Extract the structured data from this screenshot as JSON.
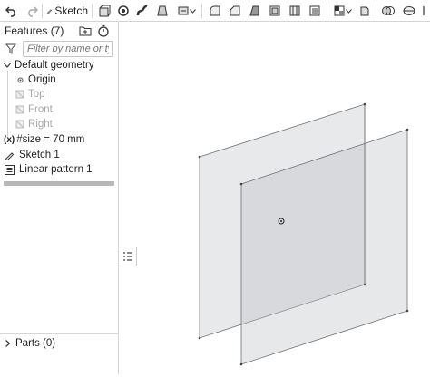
{
  "toolbar": {
    "sketch_label": "Sketch",
    "icons": [
      "undo-icon",
      "redo-icon",
      "sketch-icon",
      "extrude-icon",
      "revolve-icon",
      "sweep-icon",
      "loft-icon",
      "thicken-icon",
      "fillet-icon",
      "chamfer-icon",
      "draft-icon",
      "shell-icon",
      "hole-icon",
      "pattern-icon",
      "split-icon",
      "transform-icon",
      "boolean-icon",
      "plane-icon"
    ]
  },
  "features": {
    "title": "Features (7)",
    "filter_placeholder": "Filter by name or type",
    "default_geometry": "Default geometry",
    "origin": "Origin",
    "top": "Top",
    "front": "Front",
    "right": "Right",
    "variable": "#size = 70 mm",
    "variable_icon_text": "(x)",
    "sketch": "Sketch 1",
    "pattern": "Linear pattern 1"
  },
  "parts": {
    "label": "Parts (0)"
  },
  "colors": {
    "plane_fill": "#b8bcc2",
    "plane_edge": "#6f7277",
    "icon": "#333333"
  }
}
